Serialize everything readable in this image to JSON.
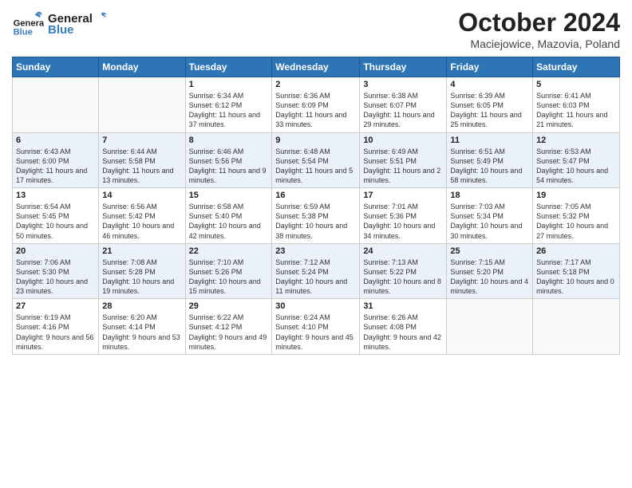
{
  "header": {
    "logo_general": "General",
    "logo_blue": "Blue",
    "month_title": "October 2024",
    "location": "Maciejowice, Mazovia, Poland"
  },
  "days_of_week": [
    "Sunday",
    "Monday",
    "Tuesday",
    "Wednesday",
    "Thursday",
    "Friday",
    "Saturday"
  ],
  "weeks": [
    [
      {
        "day": "",
        "empty": true
      },
      {
        "day": "",
        "empty": true
      },
      {
        "day": "1",
        "sunrise": "Sunrise: 6:34 AM",
        "sunset": "Sunset: 6:12 PM",
        "daylight": "Daylight: 11 hours and 37 minutes."
      },
      {
        "day": "2",
        "sunrise": "Sunrise: 6:36 AM",
        "sunset": "Sunset: 6:09 PM",
        "daylight": "Daylight: 11 hours and 33 minutes."
      },
      {
        "day": "3",
        "sunrise": "Sunrise: 6:38 AM",
        "sunset": "Sunset: 6:07 PM",
        "daylight": "Daylight: 11 hours and 29 minutes."
      },
      {
        "day": "4",
        "sunrise": "Sunrise: 6:39 AM",
        "sunset": "Sunset: 6:05 PM",
        "daylight": "Daylight: 11 hours and 25 minutes."
      },
      {
        "day": "5",
        "sunrise": "Sunrise: 6:41 AM",
        "sunset": "Sunset: 6:03 PM",
        "daylight": "Daylight: 11 hours and 21 minutes."
      }
    ],
    [
      {
        "day": "6",
        "sunrise": "Sunrise: 6:43 AM",
        "sunset": "Sunset: 6:00 PM",
        "daylight": "Daylight: 11 hours and 17 minutes."
      },
      {
        "day": "7",
        "sunrise": "Sunrise: 6:44 AM",
        "sunset": "Sunset: 5:58 PM",
        "daylight": "Daylight: 11 hours and 13 minutes."
      },
      {
        "day": "8",
        "sunrise": "Sunrise: 6:46 AM",
        "sunset": "Sunset: 5:56 PM",
        "daylight": "Daylight: 11 hours and 9 minutes."
      },
      {
        "day": "9",
        "sunrise": "Sunrise: 6:48 AM",
        "sunset": "Sunset: 5:54 PM",
        "daylight": "Daylight: 11 hours and 5 minutes."
      },
      {
        "day": "10",
        "sunrise": "Sunrise: 6:49 AM",
        "sunset": "Sunset: 5:51 PM",
        "daylight": "Daylight: 11 hours and 2 minutes."
      },
      {
        "day": "11",
        "sunrise": "Sunrise: 6:51 AM",
        "sunset": "Sunset: 5:49 PM",
        "daylight": "Daylight: 10 hours and 58 minutes."
      },
      {
        "day": "12",
        "sunrise": "Sunrise: 6:53 AM",
        "sunset": "Sunset: 5:47 PM",
        "daylight": "Daylight: 10 hours and 54 minutes."
      }
    ],
    [
      {
        "day": "13",
        "sunrise": "Sunrise: 6:54 AM",
        "sunset": "Sunset: 5:45 PM",
        "daylight": "Daylight: 10 hours and 50 minutes."
      },
      {
        "day": "14",
        "sunrise": "Sunrise: 6:56 AM",
        "sunset": "Sunset: 5:42 PM",
        "daylight": "Daylight: 10 hours and 46 minutes."
      },
      {
        "day": "15",
        "sunrise": "Sunrise: 6:58 AM",
        "sunset": "Sunset: 5:40 PM",
        "daylight": "Daylight: 10 hours and 42 minutes."
      },
      {
        "day": "16",
        "sunrise": "Sunrise: 6:59 AM",
        "sunset": "Sunset: 5:38 PM",
        "daylight": "Daylight: 10 hours and 38 minutes."
      },
      {
        "day": "17",
        "sunrise": "Sunrise: 7:01 AM",
        "sunset": "Sunset: 5:36 PM",
        "daylight": "Daylight: 10 hours and 34 minutes."
      },
      {
        "day": "18",
        "sunrise": "Sunrise: 7:03 AM",
        "sunset": "Sunset: 5:34 PM",
        "daylight": "Daylight: 10 hours and 30 minutes."
      },
      {
        "day": "19",
        "sunrise": "Sunrise: 7:05 AM",
        "sunset": "Sunset: 5:32 PM",
        "daylight": "Daylight: 10 hours and 27 minutes."
      }
    ],
    [
      {
        "day": "20",
        "sunrise": "Sunrise: 7:06 AM",
        "sunset": "Sunset: 5:30 PM",
        "daylight": "Daylight: 10 hours and 23 minutes."
      },
      {
        "day": "21",
        "sunrise": "Sunrise: 7:08 AM",
        "sunset": "Sunset: 5:28 PM",
        "daylight": "Daylight: 10 hours and 19 minutes."
      },
      {
        "day": "22",
        "sunrise": "Sunrise: 7:10 AM",
        "sunset": "Sunset: 5:26 PM",
        "daylight": "Daylight: 10 hours and 15 minutes."
      },
      {
        "day": "23",
        "sunrise": "Sunrise: 7:12 AM",
        "sunset": "Sunset: 5:24 PM",
        "daylight": "Daylight: 10 hours and 11 minutes."
      },
      {
        "day": "24",
        "sunrise": "Sunrise: 7:13 AM",
        "sunset": "Sunset: 5:22 PM",
        "daylight": "Daylight: 10 hours and 8 minutes."
      },
      {
        "day": "25",
        "sunrise": "Sunrise: 7:15 AM",
        "sunset": "Sunset: 5:20 PM",
        "daylight": "Daylight: 10 hours and 4 minutes."
      },
      {
        "day": "26",
        "sunrise": "Sunrise: 7:17 AM",
        "sunset": "Sunset: 5:18 PM",
        "daylight": "Daylight: 10 hours and 0 minutes."
      }
    ],
    [
      {
        "day": "27",
        "sunrise": "Sunrise: 6:19 AM",
        "sunset": "Sunset: 4:16 PM",
        "daylight": "Daylight: 9 hours and 56 minutes."
      },
      {
        "day": "28",
        "sunrise": "Sunrise: 6:20 AM",
        "sunset": "Sunset: 4:14 PM",
        "daylight": "Daylight: 9 hours and 53 minutes."
      },
      {
        "day": "29",
        "sunrise": "Sunrise: 6:22 AM",
        "sunset": "Sunset: 4:12 PM",
        "daylight": "Daylight: 9 hours and 49 minutes."
      },
      {
        "day": "30",
        "sunrise": "Sunrise: 6:24 AM",
        "sunset": "Sunset: 4:10 PM",
        "daylight": "Daylight: 9 hours and 45 minutes."
      },
      {
        "day": "31",
        "sunrise": "Sunrise: 6:26 AM",
        "sunset": "Sunset: 4:08 PM",
        "daylight": "Daylight: 9 hours and 42 minutes."
      },
      {
        "day": "",
        "empty": true
      },
      {
        "day": "",
        "empty": true
      }
    ]
  ]
}
